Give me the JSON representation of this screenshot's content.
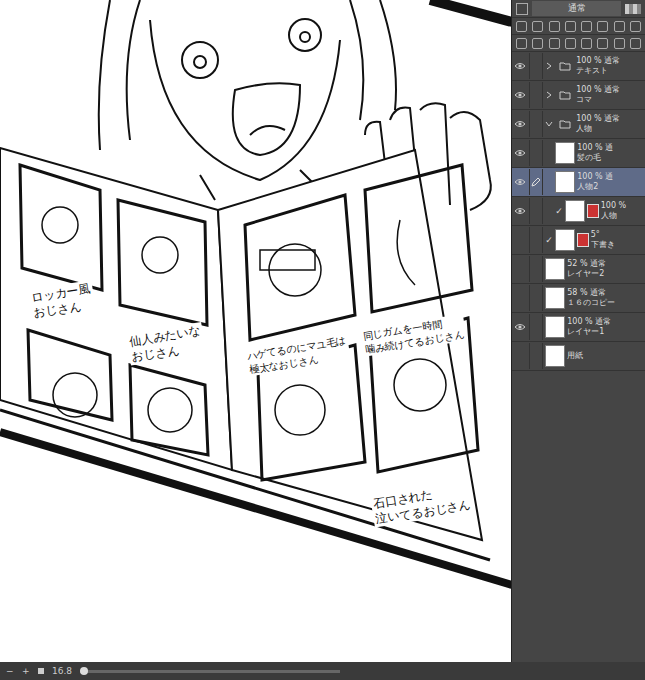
{
  "canvas": {
    "captions": [
      {
        "lines": [
          "ロッカー風",
          "おじさん"
        ]
      },
      {
        "lines": [
          "仙人みたいな",
          "おじさん"
        ]
      },
      {
        "lines": [
          "ハゲてるのにマユ毛は",
          "極太なおじさん"
        ]
      },
      {
        "lines": [
          "同じガムを一時間",
          "噛み続けてるおじさん"
        ]
      },
      {
        "lines": [
          "石口された",
          "泣いてるおじさん"
        ]
      }
    ]
  },
  "layers_panel": {
    "blend_mode": "通常",
    "layers": [
      {
        "kind": "folder",
        "info": "100 % 通常",
        "name": "テキスト",
        "visible": true,
        "selected": false,
        "expanded": false,
        "checked": false,
        "mask": false,
        "child": false
      },
      {
        "kind": "folder",
        "info": "100 % 通常",
        "name": "コマ",
        "visible": true,
        "selected": false,
        "expanded": false,
        "checked": false,
        "mask": false,
        "child": false
      },
      {
        "kind": "folder",
        "info": "100 % 通常",
        "name": "人物",
        "visible": true,
        "selected": false,
        "expanded": true,
        "checked": false,
        "mask": false,
        "child": false
      },
      {
        "kind": "layer",
        "info": "100 % 通",
        "name": "髪の毛",
        "visible": true,
        "selected": false,
        "expanded": false,
        "checked": false,
        "mask": false,
        "child": true
      },
      {
        "kind": "layer",
        "info": "100 % 通",
        "name": "人物2",
        "visible": true,
        "selected": true,
        "expanded": false,
        "checked": false,
        "mask": false,
        "child": true
      },
      {
        "kind": "layer",
        "info": "100 %",
        "name": "人物",
        "visible": true,
        "selected": false,
        "expanded": false,
        "checked": true,
        "mask": true,
        "child": true
      },
      {
        "kind": "layer",
        "info": "5°",
        "name": "下書き",
        "visible": false,
        "selected": false,
        "expanded": false,
        "checked": true,
        "mask": true,
        "child": false
      },
      {
        "kind": "layer",
        "info": "52 % 通常",
        "name": "レイヤー2",
        "visible": false,
        "selected": false,
        "expanded": false,
        "checked": false,
        "mask": false,
        "child": false
      },
      {
        "kind": "layer",
        "info": "58 % 通常",
        "name": "１６のコピー",
        "visible": false,
        "selected": false,
        "expanded": false,
        "checked": false,
        "mask": false,
        "child": false
      },
      {
        "kind": "layer",
        "info": "100 % 通常",
        "name": "レイヤー1",
        "visible": true,
        "selected": false,
        "expanded": false,
        "checked": false,
        "mask": false,
        "child": false
      },
      {
        "kind": "paper",
        "info": "",
        "name": "用紙",
        "visible": false,
        "selected": false,
        "expanded": false,
        "checked": false,
        "mask": false,
        "child": false
      }
    ]
  },
  "status_bar": {
    "minus": "−",
    "plus": "+",
    "zoom": "16.8"
  }
}
